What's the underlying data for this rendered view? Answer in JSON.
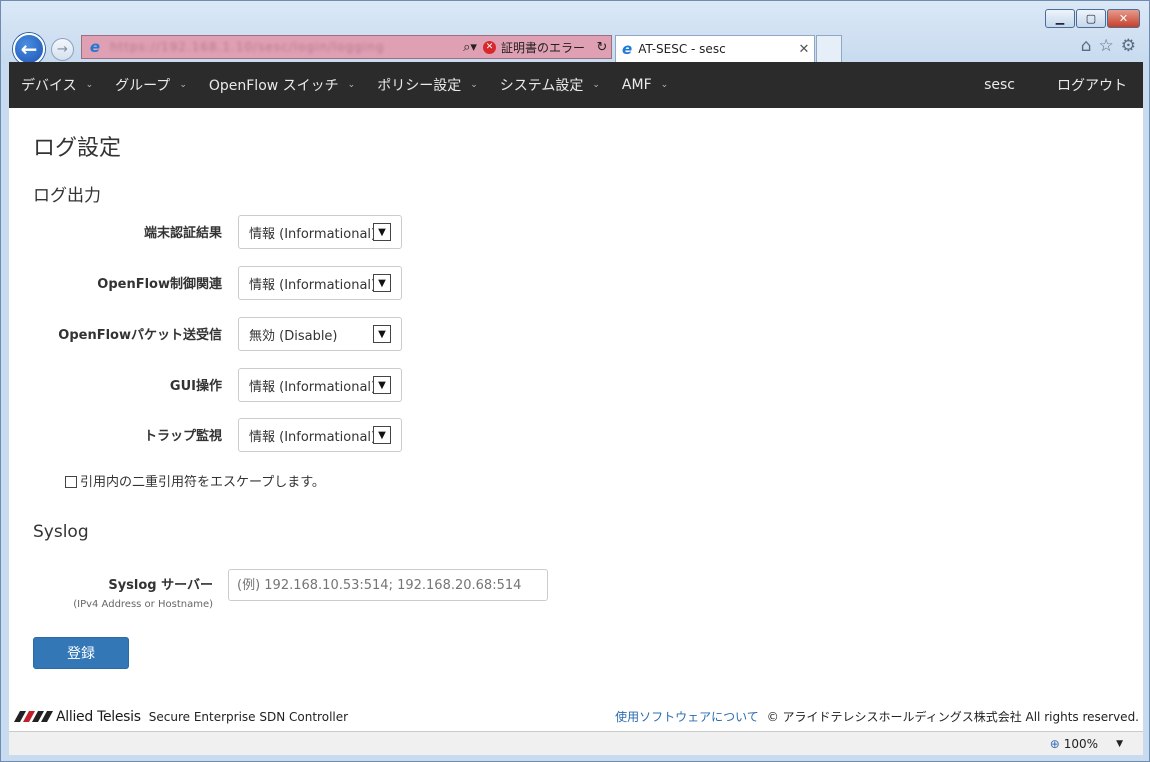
{
  "browser": {
    "address_url": "https://192.168.1.10/sesc/login/logging",
    "cert_error": "証明書のエラー",
    "tab_title": "AT-SESC - sesc"
  },
  "icons": {
    "back": "arrow-left-icon",
    "forward": "arrow-right-icon",
    "ie": "ie-logo-icon",
    "search": "search-icon",
    "cert": "cert-error-icon",
    "refresh": "refresh-icon",
    "home": "home-icon",
    "favorites": "star-icon",
    "settings": "gear-icon",
    "zoom": "zoom-icon"
  },
  "nav": {
    "items": [
      {
        "label": "デバイス"
      },
      {
        "label": "グループ"
      },
      {
        "label": "OpenFlow スイッチ"
      },
      {
        "label": "ポリシー設定"
      },
      {
        "label": "システム設定"
      },
      {
        "label": "AMF"
      }
    ],
    "user": "sesc",
    "logout": "ログアウト"
  },
  "page": {
    "title": "ログ設定",
    "log_output_title": "ログ出力",
    "fields": [
      {
        "label": "端末認証結果",
        "value": "情報 (Informational)"
      },
      {
        "label": "OpenFlow制御関連",
        "value": "情報 (Informational)"
      },
      {
        "label": "OpenFlowパケット送受信",
        "value": "無効 (Disable)"
      },
      {
        "label": "GUI操作",
        "value": "情報 (Informational)"
      },
      {
        "label": "トラップ監視",
        "value": "情報 (Informational)"
      }
    ],
    "escape_checkbox_label": "引用内の二重引用符をエスケープします。",
    "syslog_title": "Syslog",
    "syslog_label": "Syslog サーバー",
    "syslog_hint": "(IPv4 Address or Hostname)",
    "syslog_placeholder": "(例) 192.168.10.53:514; 192.168.20.68:514",
    "submit": "登録"
  },
  "footer": {
    "logo_text": "Allied Telesis",
    "product": "Secure Enterprise SDN Controller",
    "software_link": "使用ソフトウェアについて",
    "copyright": "© アライドテレシスホールディングス株式会社 All rights reserved."
  },
  "statusbar": {
    "zoom": "100%"
  },
  "colors": {
    "nav_bg": "#2b2b2b",
    "primary": "#3377b7",
    "link": "#2b6cb0",
    "cert_error": "#d8282b"
  }
}
